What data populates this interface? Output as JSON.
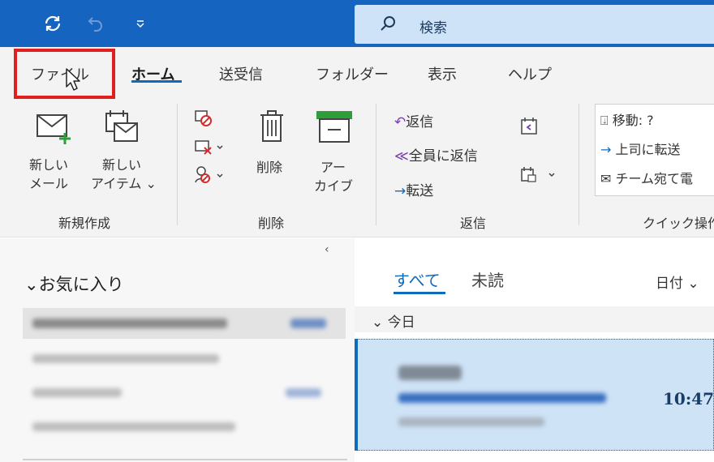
{
  "titlebar": {
    "search_placeholder": "検索",
    "icons": [
      "sync-icon",
      "undo-icon",
      "quick-access-dropdown-icon",
      "search-icon"
    ]
  },
  "tabs": [
    {
      "label": "ファイル",
      "active": false,
      "highlighted": true
    },
    {
      "label": "ホーム",
      "active": true
    },
    {
      "label": "送受信",
      "active": false
    },
    {
      "label": "フォルダー",
      "active": false
    },
    {
      "label": "表示",
      "active": false
    },
    {
      "label": "ヘルプ",
      "active": false
    }
  ],
  "ribbon": {
    "new_group": {
      "label": "新規作成",
      "new_mail": [
        "新しい",
        "メール"
      ],
      "new_item": [
        "新しい",
        "アイテム ⌄"
      ]
    },
    "delete_group": {
      "label": "削除",
      "delete": "削除",
      "archive": [
        "アー",
        "カイブ"
      ]
    },
    "reply_group": {
      "label": "返信",
      "reply": "返信",
      "reply_all": "全員に返信",
      "forward": "転送"
    },
    "quick_group": {
      "label": "クイック操作",
      "move": "移動: ?",
      "to_manager": "上司に転送",
      "team_mail": "チーム宛て電"
    }
  },
  "folders": {
    "collapse_glyph": "‹",
    "favorites_label": "お気に入り",
    "favorites_chevron": "⌄"
  },
  "mail_list": {
    "tab_all": "すべて",
    "tab_unread": "未読",
    "sort_label": "日付",
    "sort_chevron": "⌄",
    "group_today": "今日",
    "group_chevron": "⌄",
    "selected_item_time": "10:47"
  },
  "colors": {
    "titlebar": "#1565c0",
    "accent": "#0f6cbd",
    "highlight_box": "#e02020",
    "selected_mail": "#cfe3f7"
  }
}
